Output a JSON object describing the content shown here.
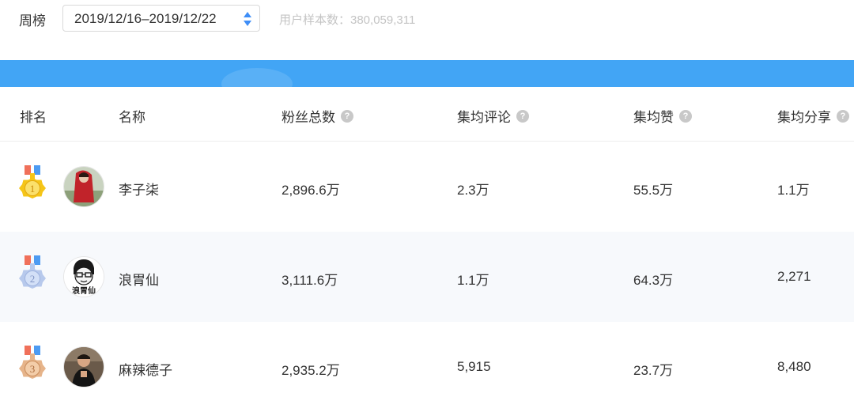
{
  "filter": {
    "period_label": "周榜",
    "date_range": "2019/12/16–2019/12/22",
    "sample_text": "用户样本数：380,059,311"
  },
  "colors": {
    "banner": "#42a5f5",
    "gold": "#f5c518",
    "silver": "#b7c9ec",
    "bronze": "#e6b48a"
  },
  "table": {
    "headers": {
      "rank": "排名",
      "name": "名称",
      "fans": "粉丝总数",
      "comments": "集均评论",
      "likes": "集均赞",
      "shares": "集均分享",
      "help_icon": "?"
    },
    "rows": [
      {
        "rank": "1",
        "medal": "gold-medal-icon",
        "name": "李子柒",
        "fans": "2,896.6万",
        "comments": "2.3万",
        "likes": "55.5万",
        "shares": "1.1万"
      },
      {
        "rank": "2",
        "medal": "silver-medal-icon",
        "name": "浪胃仙",
        "fans": "3,111.6万",
        "comments": "1.1万",
        "likes": "64.3万",
        "shares": "2,271"
      },
      {
        "rank": "3",
        "medal": "bronze-medal-icon",
        "name": "麻辣德子",
        "fans": "2,935.2万",
        "comments": "5,915",
        "likes": "23.7万",
        "shares": "8,480"
      }
    ]
  },
  "avatar_texts": {
    "row2": "浪胃仙"
  }
}
